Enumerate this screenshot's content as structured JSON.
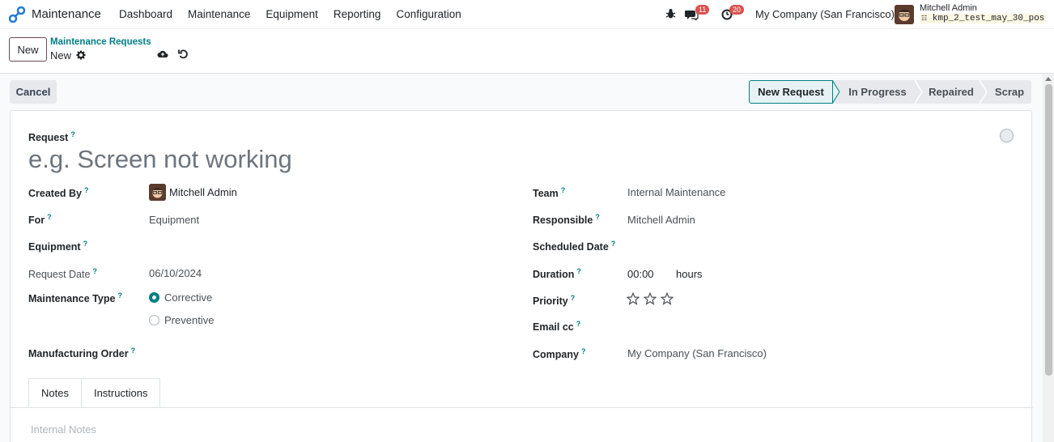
{
  "navbar": {
    "app_name": "Maintenance",
    "menu": [
      "Dashboard",
      "Maintenance",
      "Equipment",
      "Reporting",
      "Configuration"
    ],
    "messages_count": "11",
    "activities_count": "20",
    "company": "My Company (San Francisco)",
    "user_name": "Mitchell Admin",
    "db_name": "kmp_2_test_may_30_pos"
  },
  "control": {
    "new_label": "New",
    "breadcrumb_parent": "Maintenance Requests",
    "breadcrumb_current": "New"
  },
  "status": {
    "cancel_label": "Cancel",
    "stages": [
      "New Request",
      "In Progress",
      "Repaired",
      "Scrap"
    ],
    "active_stage": "New Request"
  },
  "form": {
    "request_label": "Request",
    "request_placeholder": "e.g. Screen not working",
    "left": {
      "created_by_label": "Created By",
      "created_by_value": "Mitchell Admin",
      "for_label": "For",
      "for_value": "Equipment",
      "equipment_label": "Equipment",
      "request_date_label": "Request Date",
      "request_date_value": "06/10/2024",
      "maintenance_type_label": "Maintenance Type",
      "type_options": [
        "Corrective",
        "Preventive"
      ],
      "type_selected": "Corrective",
      "manufacturing_order_label": "Manufacturing Order"
    },
    "right": {
      "team_label": "Team",
      "team_value": "Internal Maintenance",
      "responsible_label": "Responsible",
      "responsible_value": "Mitchell Admin",
      "scheduled_date_label": "Scheduled Date",
      "duration_label": "Duration",
      "duration_value": "00:00",
      "duration_unit": "hours",
      "priority_label": "Priority",
      "priority_stars": 0,
      "priority_max": 3,
      "email_cc_label": "Email cc",
      "company_label": "Company",
      "company_value": "My Company (San Francisco)"
    },
    "tabs": [
      "Notes",
      "Instructions"
    ],
    "active_tab": "Notes",
    "notes_placeholder": "Internal Notes",
    "help_mark": "?"
  },
  "colors": {
    "primary": "#017e84",
    "brand": "#714b67",
    "badge": "#d9534f"
  }
}
